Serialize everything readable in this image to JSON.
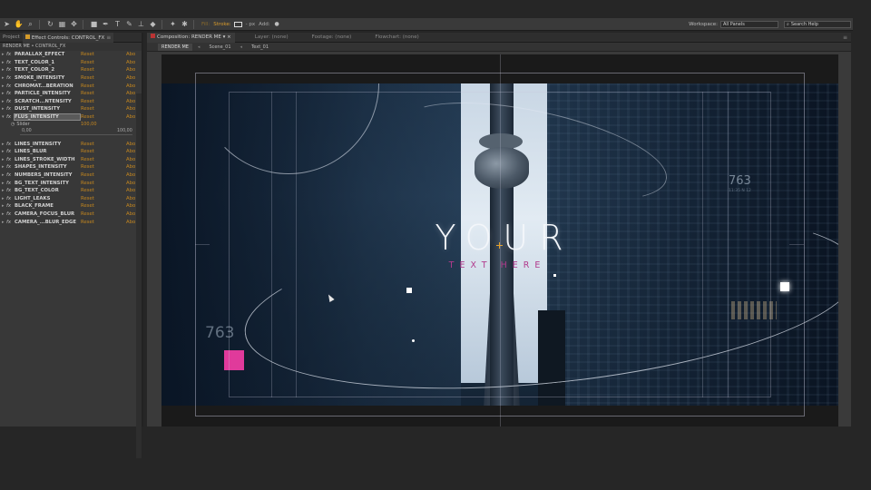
{
  "toolbar": {
    "fill_label": "Fill:",
    "stroke_label": "Stroke:",
    "px_label": "- px",
    "add_label": "Add:",
    "workspace_label": "Workspace:",
    "workspace_value": "All Panels",
    "search_placeholder": "Search Help"
  },
  "left_panel": {
    "tabs": [
      {
        "label": "Project"
      },
      {
        "label": "Effect Controls: CONTROL_FX"
      }
    ],
    "breadcrumb": "RENDER ME • CONTROL_FX",
    "reset_label": "Reset",
    "about_label": "Abo",
    "effects_top": [
      {
        "name": "PARALLAX_EFFECT"
      },
      {
        "name": "TEXT_COLOR_1"
      },
      {
        "name": "TEXT_COLOR_2"
      },
      {
        "name": "SMOKE_INTENSITY"
      },
      {
        "name": "CHROMAT...BERATION"
      },
      {
        "name": "PARTICLE_INTENSITY"
      },
      {
        "name": "SCRATCH...NTENSITY"
      },
      {
        "name": "DUST_INTENSITY"
      },
      {
        "name": "FLUS_INTENSITY"
      }
    ],
    "slider": {
      "label": "Slider",
      "value": "100,00",
      "min": "0,00",
      "max": "100,00"
    },
    "effects_bottom": [
      {
        "name": "LINES_INTENSITY"
      },
      {
        "name": "LINES_BLUR"
      },
      {
        "name": "LINES_STROKE_WIDTH"
      },
      {
        "name": "SHAPES_INTENSITY"
      },
      {
        "name": "NUMBERS_INTENSITY"
      },
      {
        "name": "BG_TEXT_INTENSITY"
      },
      {
        "name": "BG_TEXT_COLOR"
      },
      {
        "name": "LIGHT_LEAKS"
      },
      {
        "name": "BLACK_FRAME"
      },
      {
        "name": "CAMERA_FOCUS_BLUR"
      },
      {
        "name": "CAMERA_...BLUR_EDGE"
      }
    ]
  },
  "comp_panel": {
    "tabs": [
      {
        "label": "Composition: RENDER ME"
      },
      {
        "label": "Layer: (none)"
      },
      {
        "label": "Footage: (none)"
      },
      {
        "label": "Flowchart: (none)"
      }
    ],
    "breadcrumbs": [
      {
        "label": "RENDER ME"
      },
      {
        "label": "Scene_01"
      },
      {
        "label": "Text_01"
      }
    ]
  },
  "viewer": {
    "title": "YOUR",
    "subtitle": "TEXT HERE",
    "number_right": "763",
    "number_right_sub": "11:35 N 12",
    "number_left": "763"
  },
  "colors": {
    "accent_orange": "#c7881e",
    "subtitle_magenta": "#b13a8c",
    "pink_box": "#e03a9b"
  }
}
